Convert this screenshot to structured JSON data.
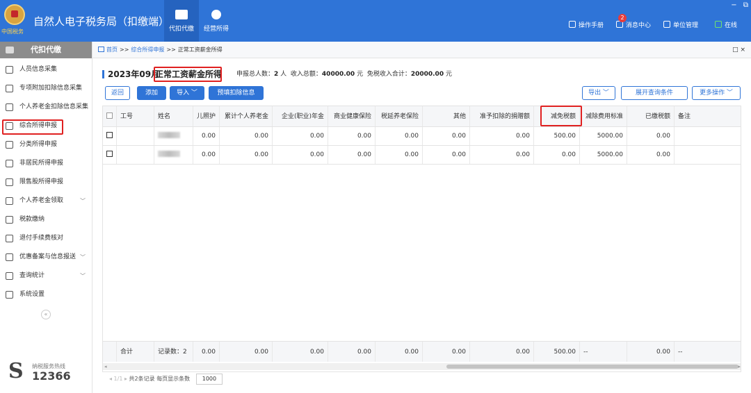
{
  "app": {
    "title": "自然人电子税务局（扣缴端）",
    "emblem_text": "中国税务",
    "modules": [
      {
        "label": "代扣代缴",
        "active": true
      },
      {
        "label": "经营所得",
        "active": false
      }
    ],
    "tools": {
      "manual": "操作手册",
      "messages": "消息中心",
      "messages_badge": "2",
      "unit": "单位管理",
      "status": "在线"
    },
    "window_controls": [
      "−",
      "⧉",
      "✕"
    ]
  },
  "sidebar": {
    "header": "代扣代缴",
    "items": [
      {
        "label": "人员信息采集",
        "icon": "person-icon",
        "arrow": ""
      },
      {
        "label": "专项附加扣除信息采集",
        "icon": "list-icon",
        "arrow": ""
      },
      {
        "label": "个人养老金扣除信息采集",
        "icon": "pension-icon",
        "arrow": ""
      },
      {
        "label": "综合所得申报",
        "icon": "layers-icon",
        "arrow": ""
      },
      {
        "label": "分类所得申报",
        "icon": "pie-icon",
        "arrow": ""
      },
      {
        "label": "非居民所得申报",
        "icon": "person-icon",
        "arrow": ""
      },
      {
        "label": "限售股所得申报",
        "icon": "bar-chart-icon",
        "arrow": ""
      },
      {
        "label": "个人养老金领取",
        "icon": "pension-icon",
        "arrow": "﹀"
      },
      {
        "label": "税款缴纳",
        "icon": "wallet-icon",
        "arrow": ""
      },
      {
        "label": "退付手续费核对",
        "icon": "document-icon",
        "arrow": ""
      },
      {
        "label": "优惠备案与信息报送",
        "icon": "file-icon",
        "arrow": "﹀"
      },
      {
        "label": "查询统计",
        "icon": "search-list-icon",
        "arrow": "﹀"
      },
      {
        "label": "系统设置",
        "icon": "gear-icon",
        "arrow": ""
      }
    ],
    "collapse": "«",
    "hotline_label": "纳税服务热线",
    "hotline_number": "12366"
  },
  "breadcrumb": {
    "home": "首页",
    "sep": ">>",
    "level1": "综合所得申报",
    "current": "正常工资薪金所得",
    "close": "□ ×"
  },
  "summary": {
    "period": "2023年09月",
    "income_type": "正常工资薪金所得",
    "count_label": "申报总人数：",
    "count": "2",
    "count_unit": "人",
    "income_label": "收入总额：",
    "income": "40000.00",
    "income_unit": "元",
    "exempt_label": "免税收入合计：",
    "exempt": "20000.00",
    "exempt_unit": "元"
  },
  "toolbar": {
    "back": "返回",
    "add": "添加",
    "import": "导入 ﹀",
    "prefill": "预填扣除信息",
    "export": "导出 ﹀",
    "expand_query": "展开查询条件",
    "more": "更多操作 ﹀"
  },
  "table": {
    "headers": [
      "",
      "工号",
      "姓名",
      "儿照护",
      "累计个人养老金",
      "企业(职业)年金",
      "商业健康保险",
      "税延养老保险",
      "其他",
      "准予扣除的捐赠额",
      "减免税额",
      "减除费用标准",
      "已缴税额",
      "备注"
    ],
    "rows": [
      [
        "",
        "",
        "",
        "0.00",
        "0.00",
        "0.00",
        "0.00",
        "0.00",
        "0.00",
        "0.00",
        "500.00",
        "5000.00",
        "0.00",
        ""
      ],
      [
        "",
        "",
        "",
        "0.00",
        "0.00",
        "0.00",
        "0.00",
        "0.00",
        "0.00",
        "0.00",
        "0.00",
        "5000.00",
        "0.00",
        ""
      ]
    ],
    "footer": [
      "",
      "合计",
      "记录数：2",
      "0.00",
      "0.00",
      "0.00",
      "0.00",
      "0.00",
      "0.00",
      "0.00",
      "500.00",
      "--",
      "0.00",
      "--"
    ]
  },
  "pager": {
    "nav": "◂ 1/1 ▸",
    "total": "共2条记录",
    "size_label": "每页显示条数",
    "size": "1000"
  },
  "colors": {
    "brand": "#2f74d7",
    "highlight": "#e02020"
  }
}
